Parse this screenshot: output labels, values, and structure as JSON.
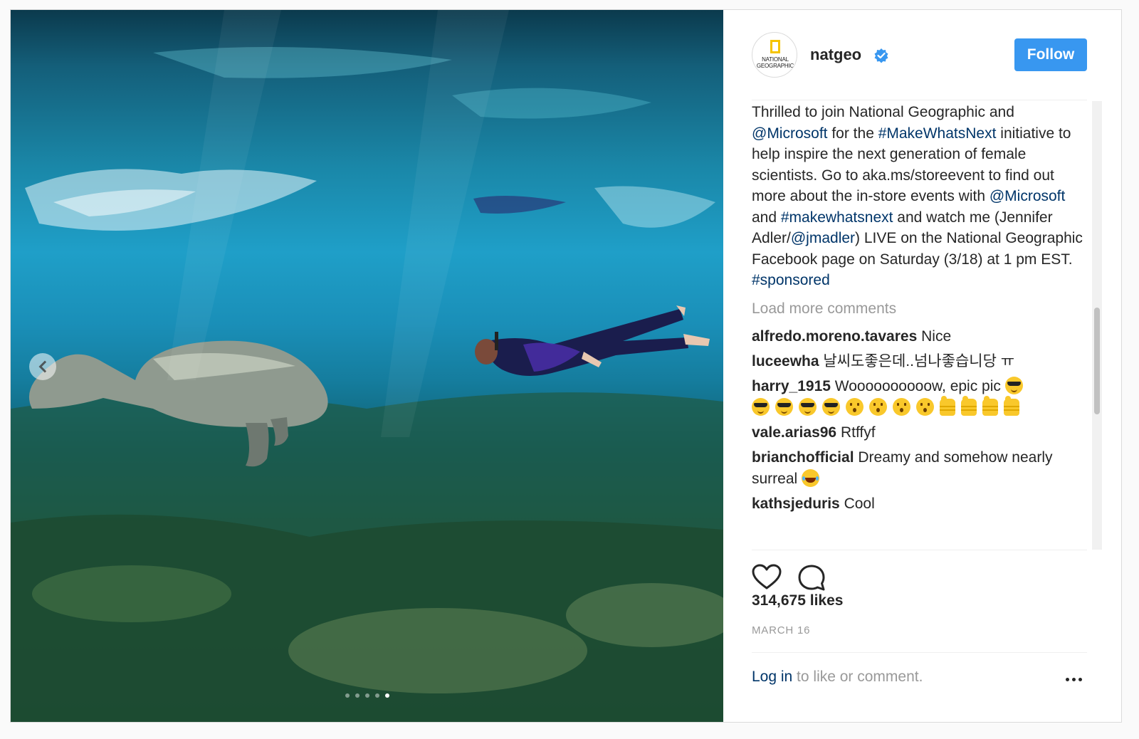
{
  "post": {
    "image_alt": "Underwater photo of a manatee and a snorkeler",
    "carousel": {
      "total": 5,
      "active": 4,
      "prev_icon": "chevron-left-icon"
    },
    "author": {
      "avatar_text_line1": "NATIONAL",
      "avatar_text_line2": "GEOGRAPHIC",
      "username": "natgeo",
      "verified_icon": "verified-badge-icon"
    },
    "follow_label": "Follow",
    "caption": {
      "t1": "Thrilled to join National Geographic and ",
      "l1": "@Microsoft",
      "t2": " for the ",
      "l2": "#MakeWhatsNext",
      "t3": " initiative to help inspire the next generation of female scientists. Go to aka.ms/storeevent to find out more about the in-store events with ",
      "l3": "@Microsoft",
      "t4": " and ",
      "l4": "#makewhatsnext",
      "t5": " and watch me (Jennifer Adler/",
      "l5": "@jmadler",
      "t6": ") LIVE on the National Geographic Facebook page on Saturday (3/18) at 1 pm EST. ",
      "l6": "#sponsored"
    },
    "load_more": "Load more comments",
    "comments": [
      {
        "user": "alfredo.moreno.tavares",
        "text": "Nice"
      },
      {
        "user": "luceewha",
        "text": "날씨도좋은데..넘나좋습니당 ㅠ"
      },
      {
        "user": "harry_1915",
        "text": "Woooooooooow, epic pic"
      },
      {
        "user": "vale.arias96",
        "text": "Rtffyf"
      },
      {
        "user": "brianchofficial",
        "text": "Dreamy and somehow nearly surreal"
      },
      {
        "user": "kathsjeduris",
        "text": "Cool"
      }
    ],
    "likes": "314,675 likes",
    "date": "MARCH 16",
    "login_link": "Log in",
    "login_rest": " to like or comment.",
    "colors": {
      "accent": "#3897f0",
      "link": "#003569",
      "muted": "#999999"
    }
  }
}
